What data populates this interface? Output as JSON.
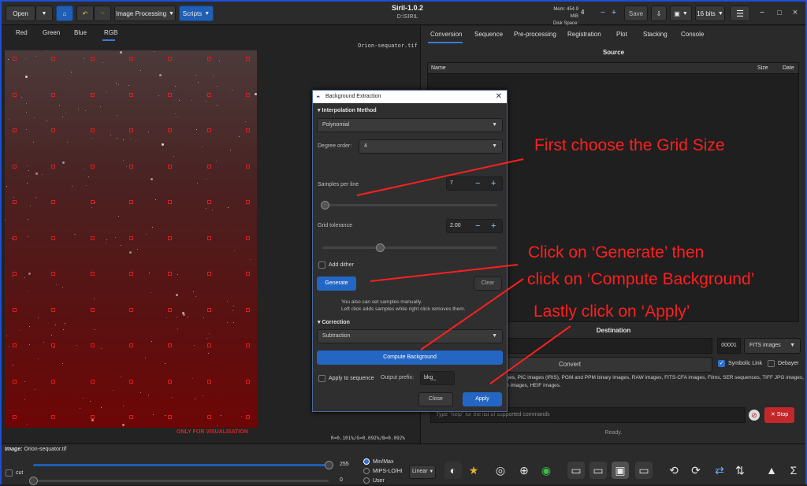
{
  "header": {
    "open_label": "Open",
    "image_processing_label": "Image Processing",
    "scripts_label": "Scripts",
    "app_title": "Siril-1.0.2",
    "working_dir": "D:\\SIRIL",
    "mem_label": "Mem: 454.9 MiB",
    "disk_label": "Disk Space: 60.0 GiB",
    "threads": "4",
    "save_label": "Save",
    "bits_label": "16 bits"
  },
  "left_tabs": [
    "Red",
    "Green",
    "Blue",
    "RGB"
  ],
  "image": {
    "filename": "Orion-sequator.tif",
    "visualisation_note": "ONLY FOR VISUALISATION",
    "readout": "R=0.101%/G=0.092%/B=0.092%"
  },
  "right_tabs": [
    "Conversion",
    "Sequence",
    "Pre-processing",
    "Registration",
    "Plot",
    "Stacking",
    "Console"
  ],
  "conversion": {
    "source_title": "Source",
    "columns": [
      "Name",
      "Size",
      "Date"
    ],
    "destination_title": "Destination",
    "start_index": "00001",
    "output_type": "FITS images",
    "convert_label": "Convert",
    "symbolic_link_label": "Symbolic Link",
    "debayer_label": "Debayer",
    "supported_text": "images, PIC images (IRIS), PGM and PPM binary images, RAW images, FITS-CFA images, Films, SER sequences, TIFF JPG images, PNG images, HEIF images."
  },
  "console": {
    "placeholder": "Type \"help\" for the list of supported commands",
    "stop_label": "Stop",
    "status": "Ready."
  },
  "dialog": {
    "title": "Background Extraction",
    "interpolation_header": "Interpolation Method",
    "method": "Polynomial",
    "degree_label": "Degree order:",
    "degree_value": "4",
    "samples_label": "Samples per line",
    "samples_value": "7",
    "tolerance_label": "Grid tolerance",
    "tolerance_value": "2.00",
    "add_dither_label": "Add dither",
    "generate_label": "Generate",
    "clear_label": "Clear",
    "hint_line1": "You also can set samples manually.",
    "hint_line2": "Left click adds samples while right click removes them.",
    "correction_header": "Correction",
    "correction_value": "Subtraction",
    "compute_label": "Compute Background",
    "apply_seq_label": "Apply to sequence",
    "prefix_label": "Output prefix:",
    "prefix_value": "bkg_",
    "close_label": "Close",
    "apply_label": "Apply"
  },
  "annotations": {
    "grid": "First choose the Grid Size",
    "generate_1": "Click on ‘Generate’ then",
    "generate_2": "click on ‘Compute Background’",
    "apply": "Lastly click on ‘Apply’"
  },
  "bottom": {
    "image_prefix": "Image:",
    "image_name": "Orion-sequator.tif",
    "cut_label": "cut",
    "max_value": "255",
    "min_value": "0",
    "modes": [
      "Min/Max",
      "MIPS-LO/HI",
      "User"
    ],
    "selected_mode": "Min/Max",
    "scale": "Linear"
  },
  "colors": {
    "accent": "#2466c4",
    "annotation": "#ff1f1f",
    "sample_box": "#e11b1b"
  }
}
